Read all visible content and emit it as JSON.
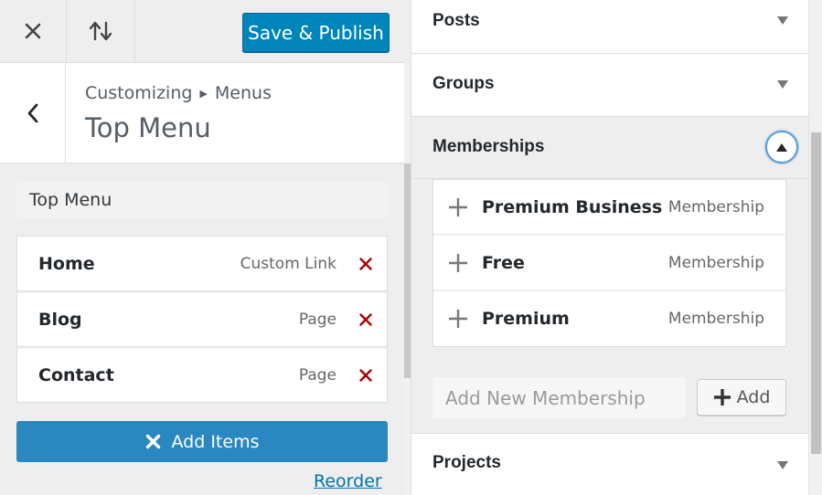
{
  "toolbar": {
    "close_icon": "close-icon",
    "sort_icon": "sort-arrows-icon",
    "save_label": "Save & Publish"
  },
  "header": {
    "breadcrumb_root": "Customizing",
    "breadcrumb_section": "Menus",
    "title": "Top Menu"
  },
  "menu": {
    "name_value": "Top Menu",
    "items": [
      {
        "title": "Home",
        "type": "Custom Link"
      },
      {
        "title": "Blog",
        "type": "Page"
      },
      {
        "title": "Contact",
        "type": "Page"
      }
    ],
    "add_items_label": "Add Items",
    "reorder_label": "Reorder"
  },
  "available": {
    "sections": {
      "posts": "Posts",
      "groups": "Groups",
      "memberships": "Memberships",
      "projects": "Projects"
    },
    "memberships": [
      {
        "name": "Premium Business",
        "kind": "Membership"
      },
      {
        "name": "Free",
        "kind": "Membership"
      },
      {
        "name": "Premium",
        "kind": "Membership"
      }
    ],
    "add_new_placeholder": "Add New Membership",
    "add_label": "Add"
  },
  "colors": {
    "primary": "#0085ba",
    "add_items": "#2b87bf",
    "remove": "#aa0000",
    "link": "#0073aa"
  }
}
